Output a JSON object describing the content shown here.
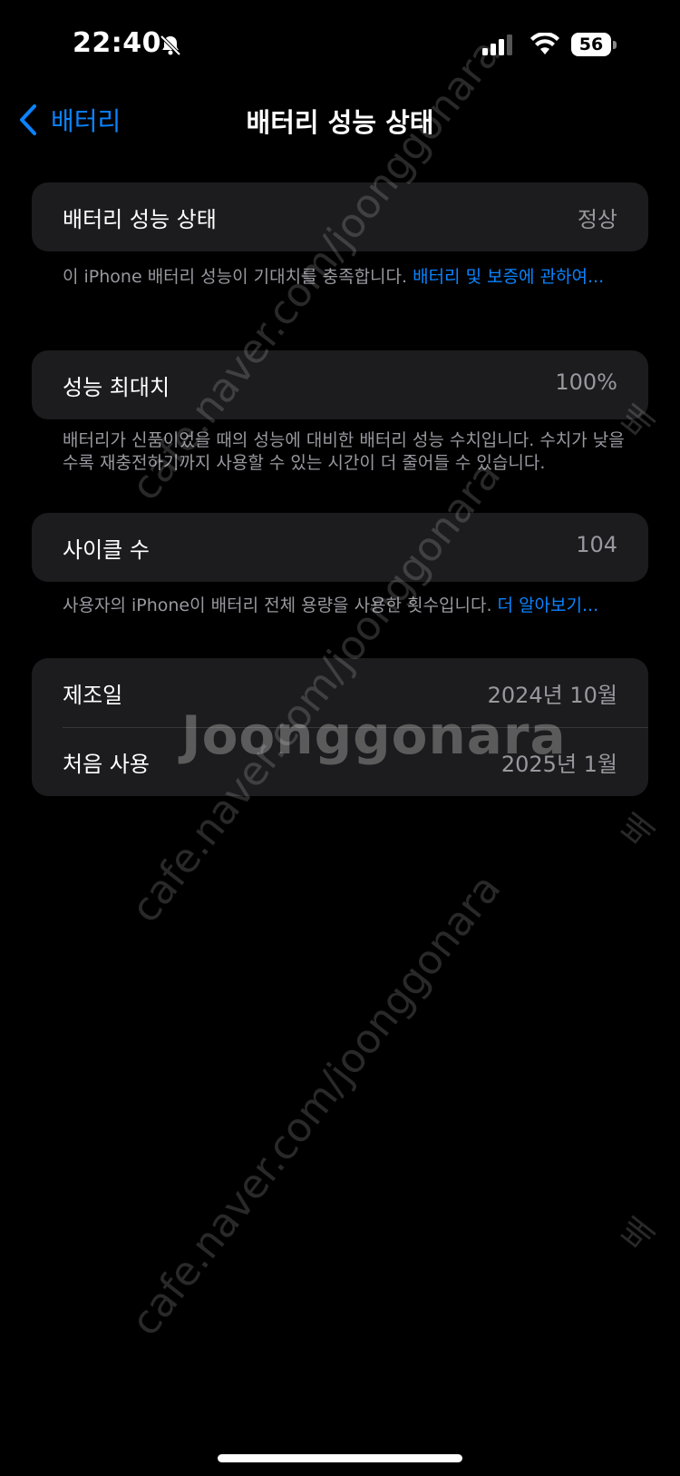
{
  "status_bar": {
    "time": "22:40",
    "battery_level": "56"
  },
  "nav": {
    "back_label": "배터리",
    "title": "배터리 성능 상태"
  },
  "sections": {
    "health": {
      "label": "배터리 성능 상태",
      "value": "정상",
      "footnote_text": "이 iPhone 배터리 성능이 기대치를 충족합니다. ",
      "footnote_link": "배터리 및 보증에 관하여..."
    },
    "max_capacity": {
      "label": "성능 최대치",
      "value": "100%",
      "footnote_text": "배터리가 신품이었을 때의 성능에 대비한 배터리 성능 수치입니다. 수치가 낮을수록 재충전하기까지 사용할 수 있는 시간이 더 줄어들 수 있습니다."
    },
    "cycle_count": {
      "label": "사이클 수",
      "value": "104",
      "footnote_text": "사용자의 iPhone이 배터리 전체 용량을 사용한 횟수입니다. ",
      "footnote_link": "더 알아보기..."
    },
    "dates": {
      "manufacture_label": "제조일",
      "manufacture_value": "2024년 10월",
      "first_use_label": "처음 사용",
      "first_use_value": "2025년 1월"
    }
  },
  "watermark": {
    "url_text": "cafe.naver.com/joonggonara",
    "logo_text": "Joonggonara",
    "side_text": "배"
  },
  "colors": {
    "accent": "#0a84ff",
    "background": "#000000",
    "card": "#1c1c1e",
    "secondary_text": "#98989f"
  }
}
